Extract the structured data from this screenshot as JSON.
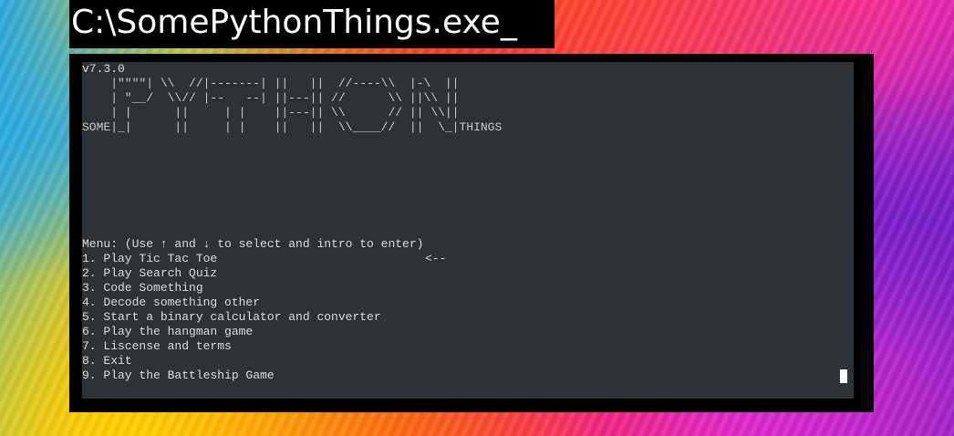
{
  "window": {
    "title": "C:\\SomePythonThings.exe_"
  },
  "console": {
    "version": "v7.3.0",
    "banner": [
      "    |\"\"\"\"| \\\\  //|-------| ||   ||  //----\\\\  |-\\  ||",
      "    | \"__/  \\\\// |--   --| ||---|| //      \\\\ ||\\\\ ||",
      "    | |      ||     | |    ||---|| \\\\      // || \\\\||",
      "SOME|_|      ||     | |    ||   ||  \\\\____//  ||  \\_|THINGS"
    ],
    "menu_header": "Menu: (Use ↑ and ↓ to select and intro to enter)",
    "selection_marker": "<--",
    "menu_items": [
      "1. Play Tic Tac Toe",
      "2. Play Search Quiz",
      "3. Code Something",
      "4. Decode something other",
      "5. Start a binary calculator and converter",
      "6. Play the hangman game",
      "7. Liscense and terms",
      "8. Exit",
      "9. Play the Battleship Game"
    ],
    "selected_index": 0
  },
  "colors": {
    "console_bg": "#2c3235",
    "console_text": "#dcdcdc",
    "frame": "#000000",
    "title_bg": "#000000",
    "title_text": "#ffffff"
  }
}
